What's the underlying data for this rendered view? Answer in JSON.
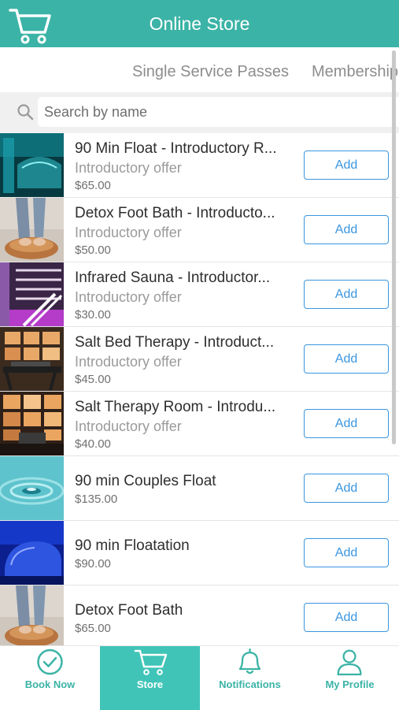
{
  "header": {
    "title": "Online Store",
    "cart_icon": "cart-icon"
  },
  "tabs": [
    "Single Service Passes",
    "Membership"
  ],
  "search": {
    "placeholder": "Search by name"
  },
  "products": [
    {
      "name": "90 Min Float - Introductory R...",
      "description": "Introductory offer",
      "price": "$65.00",
      "button": "Add"
    },
    {
      "name": "Detox Foot Bath - Introducto...",
      "description": "Introductory offer",
      "price": "$50.00",
      "button": "Add"
    },
    {
      "name": "Infrared Sauna - Introductor...",
      "description": "Introductory offer",
      "price": "$30.00",
      "button": "Add"
    },
    {
      "name": "Salt Bed Therapy - Introduct...",
      "description": "Introductory offer",
      "price": "$45.00",
      "button": "Add"
    },
    {
      "name": "Salt Therapy Room - Introdu...",
      "description": "Introductory offer",
      "price": "$40.00",
      "button": "Add"
    },
    {
      "name": "90 min Couples Float",
      "price": "$135.00",
      "button": "Add"
    },
    {
      "name": "90 min Floatation",
      "price": "$90.00",
      "button": "Add"
    },
    {
      "name": "Detox Foot Bath",
      "price": "$65.00",
      "button": "Add"
    }
  ],
  "nav": {
    "book": "Book Now",
    "store": "Store",
    "notifications": "Notifications",
    "profile": "My Profile",
    "active": "store"
  },
  "colors": {
    "brand": "#3bb3a6",
    "active_tab": "#40c4b8",
    "button": "#3a96e0"
  }
}
